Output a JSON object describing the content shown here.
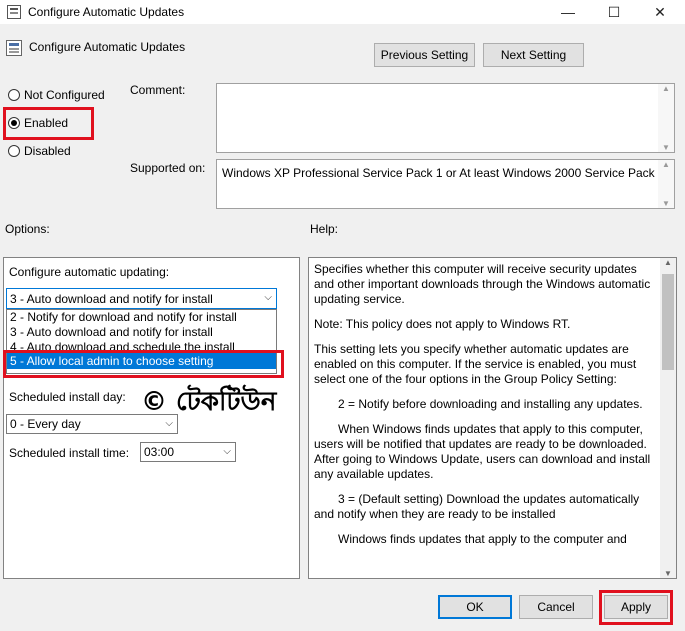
{
  "window": {
    "title": "Configure Automatic Updates",
    "minimize_glyph": "—",
    "maximize_glyph": "☐",
    "close_glyph": "✕"
  },
  "header": {
    "policy_name": "Configure Automatic Updates",
    "previous_label": "Previous Setting",
    "next_label": "Next Setting"
  },
  "state": {
    "not_configured": "Not Configured",
    "enabled": "Enabled",
    "disabled": "Disabled",
    "selected": "enabled"
  },
  "comment_label": "Comment:",
  "comment_value": "",
  "supported_label": "Supported on:",
  "supported_value": "Windows XP Professional Service Pack 1 or At least Windows 2000 Service Pack 3",
  "options_label": "Options:",
  "help_label": "Help:",
  "options": {
    "config_label": "Configure automatic updating:",
    "config_selected": "3 - Auto download and notify for install",
    "dropdown_items": [
      "2 - Notify for download and notify for install",
      "3 - Auto download and notify for install",
      "4 - Auto download and schedule the install",
      "5 - Allow local admin to choose setting"
    ],
    "highlighted_index": 3,
    "day_label": "Scheduled install day:",
    "day_value": "0 - Every day",
    "time_label": "Scheduled install time:",
    "time_value": "03:00"
  },
  "watermark": "© টেকটিউন",
  "help_paragraphs": [
    "Specifies whether this computer will receive security updates and other important downloads through the Windows automatic updating service.",
    "Note: This policy does not apply to Windows RT.",
    "This setting lets you specify whether automatic updates are enabled on this computer. If the service is enabled, you must select one of the four options in the Group Policy Setting:",
    "2 = Notify before downloading and installing any updates.",
    "When Windows finds updates that apply to this computer, users will be notified that updates are ready to be downloaded. After going to Windows Update, users can download and install any available updates.",
    "3 = (Default setting) Download the updates automatically and notify when they are ready to be installed",
    "Windows finds updates that apply to the computer and"
  ],
  "footer": {
    "ok": "OK",
    "cancel": "Cancel",
    "apply": "Apply"
  },
  "colors": {
    "highlight": "#e0101e",
    "selection": "#0078d7"
  }
}
